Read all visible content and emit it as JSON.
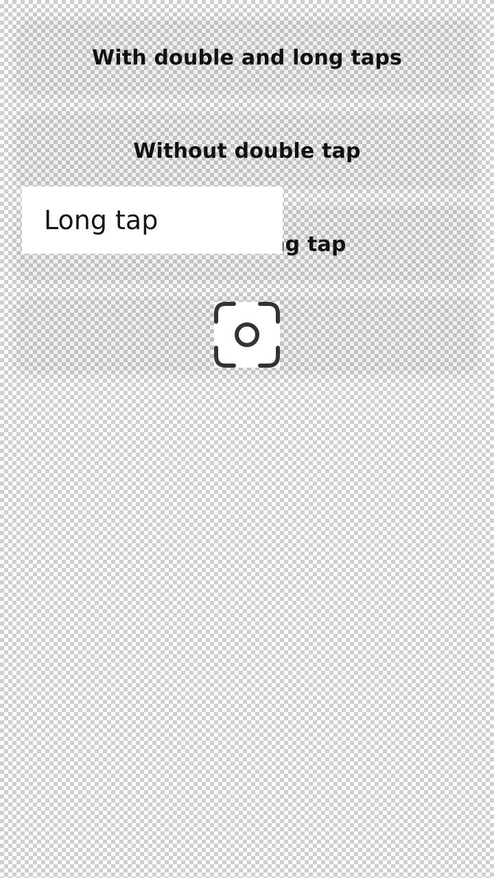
{
  "buttons": {
    "with_double_and_long": "With double and long taps",
    "without_double": "Without double tap",
    "long_tap_button": "Without long tap"
  },
  "tooltip": {
    "text": "Long tap"
  },
  "icon": {
    "name": "screenshot-scan-icon"
  }
}
